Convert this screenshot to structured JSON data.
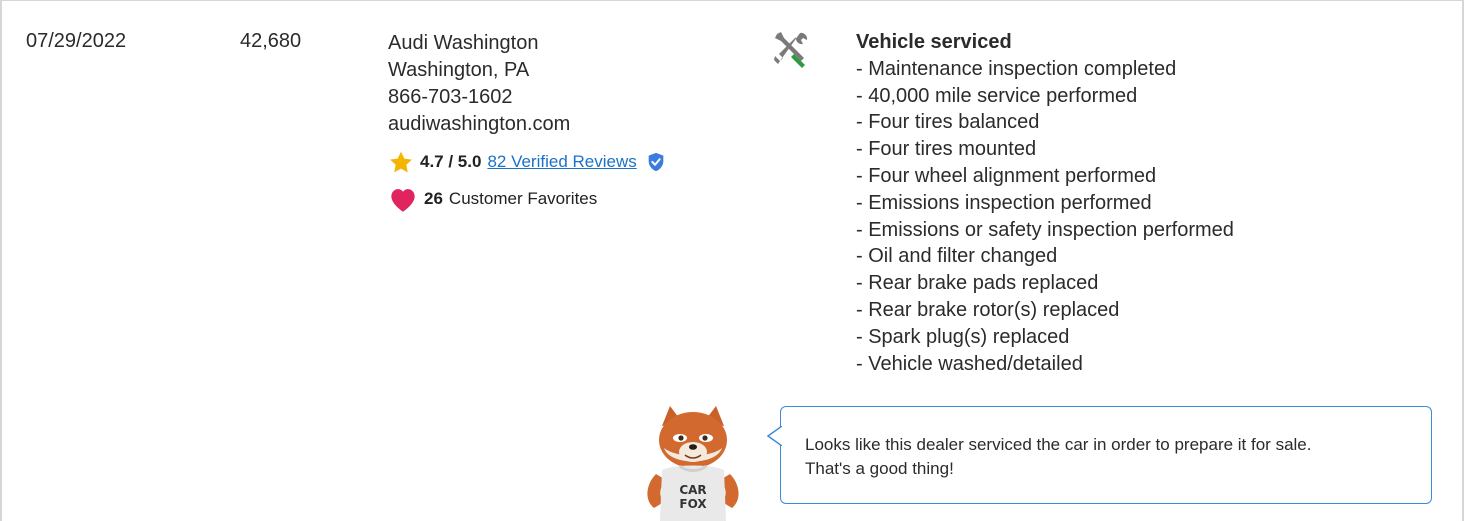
{
  "record": {
    "date": "07/29/2022",
    "odometer": "42,680",
    "dealer": {
      "name": "Audi Washington",
      "location": "Washington, PA",
      "phone": "866-703-1602",
      "website": "audiwashington.com",
      "rating": "4.7 / 5.0",
      "reviews_link": "82 Verified Reviews",
      "favorites_count": "26",
      "favorites_label": "Customer Favorites"
    },
    "event_title": "Vehicle serviced",
    "service_items": [
      "- Maintenance inspection completed",
      "- 40,000 mile service performed",
      "- Four tires balanced",
      "- Four tires mounted",
      "- Four wheel alignment performed",
      "- Emissions inspection performed",
      "- Emissions or safety inspection performed",
      "- Oil and filter changed",
      "- Rear brake pads replaced",
      "- Rear brake rotor(s) replaced",
      "- Spark plug(s) replaced",
      "- Vehicle washed/detailed"
    ]
  },
  "mascot": {
    "shirt_text": "CAR FOX",
    "tip_line1": "Looks like this dealer serviced the car in order to prepare it for sale.",
    "tip_line2": "That's a good thing!"
  },
  "colors": {
    "link": "#1a73c8",
    "star": "#f5b400",
    "heart": "#e0245e",
    "verified_badge": "#3b7ddd",
    "bubble_border": "#3d8bd8",
    "tool_green": "#2e9b3f"
  },
  "icons": [
    "star-icon",
    "verified-badge-icon",
    "heart-icon",
    "wrench-screwdriver-icon",
    "carfox-mascot"
  ]
}
